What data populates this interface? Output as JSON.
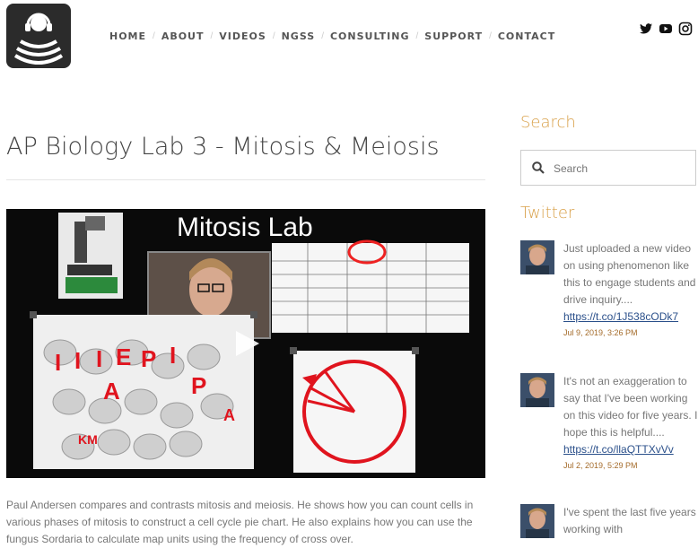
{
  "nav": {
    "items": [
      "HOME",
      "ABOUT",
      "VIDEOS",
      "NGSS",
      "CONSULTING",
      "SUPPORT",
      "CONTACT"
    ]
  },
  "social": {
    "icons": [
      "twitter-icon",
      "youtube-icon",
      "instagram-icon"
    ]
  },
  "main": {
    "title": "AP Biology Lab 3 - Mitosis & Meiosis",
    "video": {
      "heading": "Mitosis Lab",
      "letters": [
        "I",
        "I",
        "I",
        "E",
        "P",
        "I",
        "A",
        "P",
        "A",
        "KM"
      ]
    },
    "description": "Paul Andersen compares and contrasts mitosis and meiosis. He shows how you can count cells in various phases of mitosis to construct a cell cycle pie chart. He also explains how you can use the fungus Sordaria to calculate map units using the frequency of cross over."
  },
  "sidebar": {
    "search_heading": "Search",
    "search_placeholder": "Search",
    "twitter_heading": "Twitter",
    "tweets": [
      {
        "text": "Just uploaded a new video on using phenomenon like this to engage students and drive inquiry....",
        "link": "https://t.co/1J538cODk7",
        "date": "Jul 9, 2019, 3:26 PM"
      },
      {
        "text": "It's not an exaggeration to say that I've been working on this video for five years. I hope this is helpful....",
        "link": "https://t.co/llaQTTXvVv",
        "date": "Jul 2, 2019, 5:29 PM"
      },
      {
        "text": "I've spent the last five years working with",
        "link": "",
        "date": ""
      }
    ]
  },
  "colors": {
    "accent": "#d9a14a",
    "link": "#2a4f8a",
    "logo_bg": "#2b2b2b"
  }
}
